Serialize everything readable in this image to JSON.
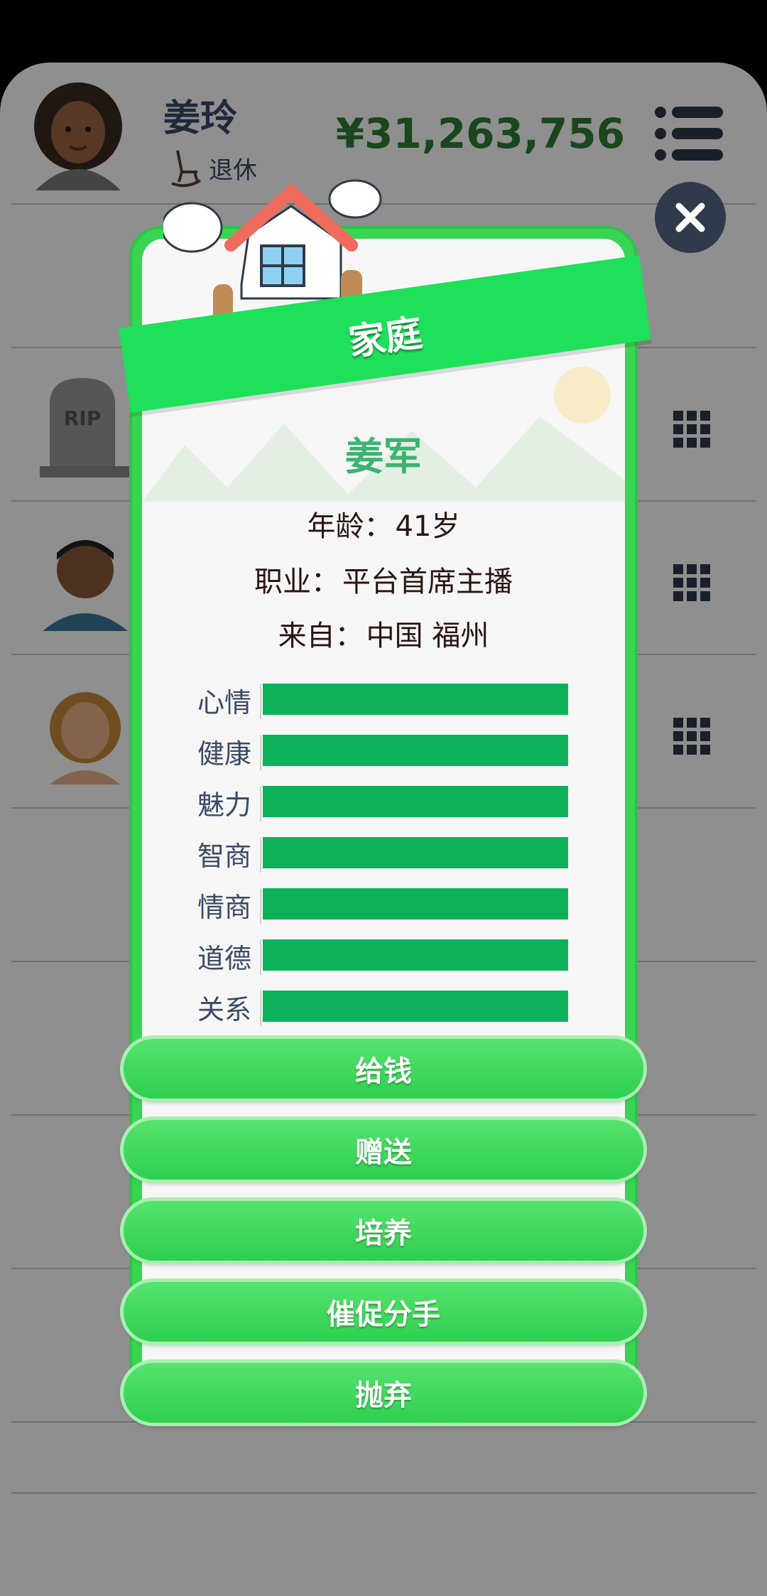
{
  "header": {
    "player_name": "姜玲",
    "status": "退休",
    "money": "¥31,263,756"
  },
  "modal": {
    "title": "家庭",
    "person": {
      "name": "姜军",
      "age_label": "年龄：",
      "age_value": "41岁",
      "job_label": "职业：",
      "job_value": "平台首席主播",
      "from_label": "来自：",
      "from_value": "中国 福州"
    },
    "stats": [
      {
        "label": "心情",
        "value": 1.0
      },
      {
        "label": "健康",
        "value": 1.0
      },
      {
        "label": "魅力",
        "value": 1.0
      },
      {
        "label": "智商",
        "value": 1.0
      },
      {
        "label": "情商",
        "value": 1.0
      },
      {
        "label": "道德",
        "value": 1.0
      },
      {
        "label": "关系",
        "value": 1.0
      }
    ],
    "buttons": [
      "给钱",
      "赠送",
      "培养",
      "催促分手",
      "抛弃"
    ]
  },
  "background_rows": {
    "grave_text": "RIP"
  },
  "colors": {
    "accent_green": "#37d552",
    "stat_bar": "#0db15a",
    "money": "#2e7d32",
    "name": "#3cb371"
  },
  "icons": [
    "menu-icon",
    "rocking-chair-icon",
    "close-icon",
    "grid-icon",
    "house-icon",
    "tombstone-icon"
  ]
}
